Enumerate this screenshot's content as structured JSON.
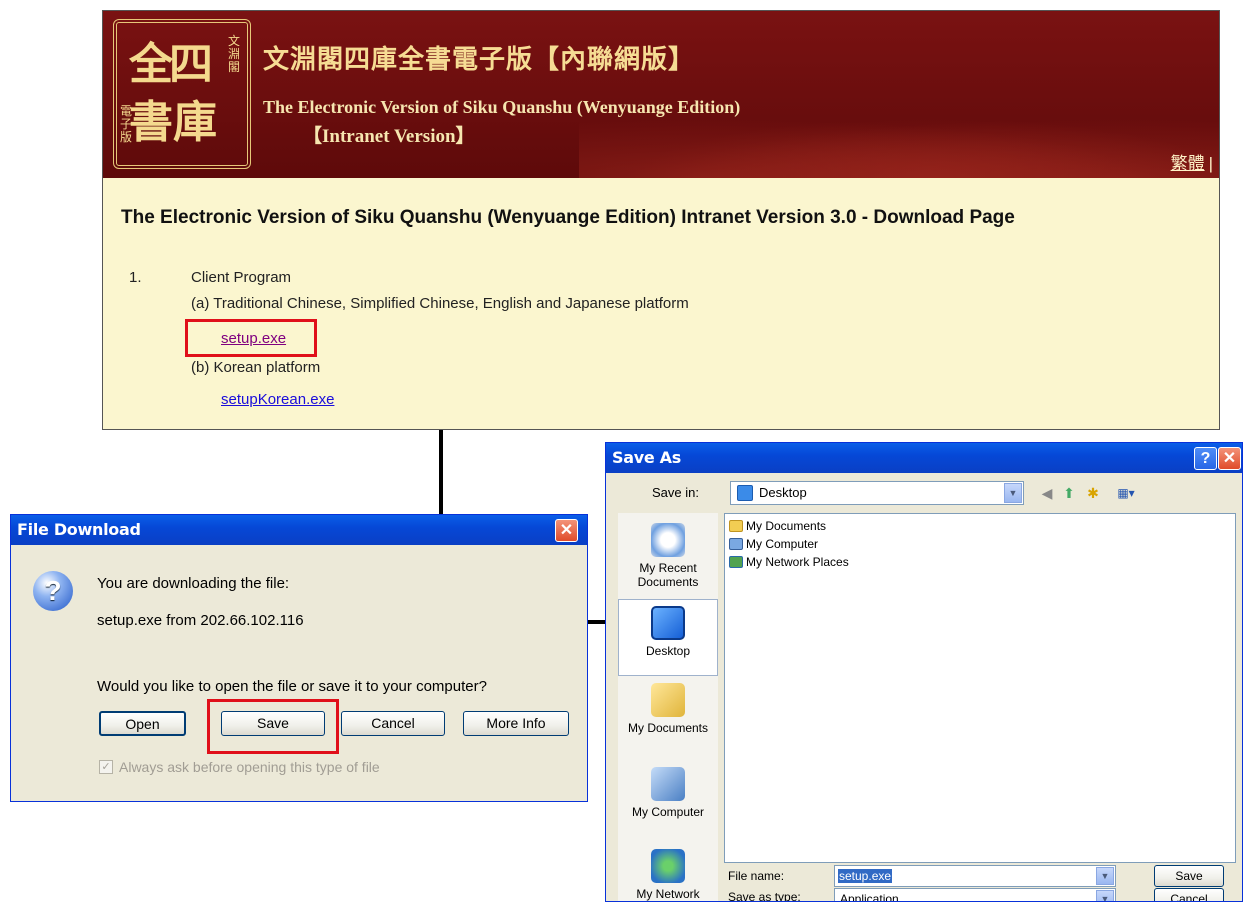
{
  "webpage": {
    "seal": {
      "big_chars": [
        "全",
        "四",
        "書",
        "庫"
      ],
      "small_top": "文淵閣",
      "small_left": "電子版"
    },
    "banner_title_cn": "文淵閣四庫全書電子版【內聯網版】",
    "banner_title_en": "The Electronic Version of Siku Quanshu (Wenyuange Edition)",
    "banner_title_en2": "【Intranet Version】",
    "lang_link": "繁體",
    "heading": "The Electronic Version of Siku Quanshu (Wenyuange Edition) Intranet Version 3.0 - Download Page",
    "item_number": "1.",
    "item_title": "Client Program",
    "item_a": "(a) Traditional Chinese, Simplified Chinese, English and Japanese platform",
    "link_setup": "setup.exe",
    "item_b": "(b) Korean platform",
    "link_korean": "setupKorean.exe"
  },
  "file_download": {
    "title": "File Download",
    "close_glyph": "✕",
    "icon_glyph": "?",
    "text1": "You are downloading the file:",
    "text2": "setup.exe from 202.66.102.116",
    "question": "Would you like to open the file or save it to your computer?",
    "buttons": {
      "open": "Open",
      "save": "Save",
      "cancel": "Cancel",
      "more_info": "More Info"
    },
    "checkbox_label": "Always ask before opening this type of file",
    "checkbox_checked": true
  },
  "save_as": {
    "title": "Save As",
    "help_glyph": "?",
    "close_glyph": "✕",
    "save_in_label": "Save in:",
    "save_in_value": "Desktop",
    "places": [
      "My Recent Documents",
      "Desktop",
      "My Documents",
      "My Computer",
      "My Network"
    ],
    "files": [
      "My Documents",
      "My Computer",
      "My Network Places"
    ],
    "file_name_label": "File name:",
    "file_name_value": "setup.exe",
    "save_as_type_label": "Save as type:",
    "save_as_type_value": "Application",
    "buttons": {
      "save": "Save",
      "cancel": "Cancel"
    }
  },
  "colors": {
    "banner": "#6e0f0f",
    "page_bg": "#fbf6cf",
    "highlight": "#e0101a",
    "xp_title": "#0a5fe8"
  }
}
